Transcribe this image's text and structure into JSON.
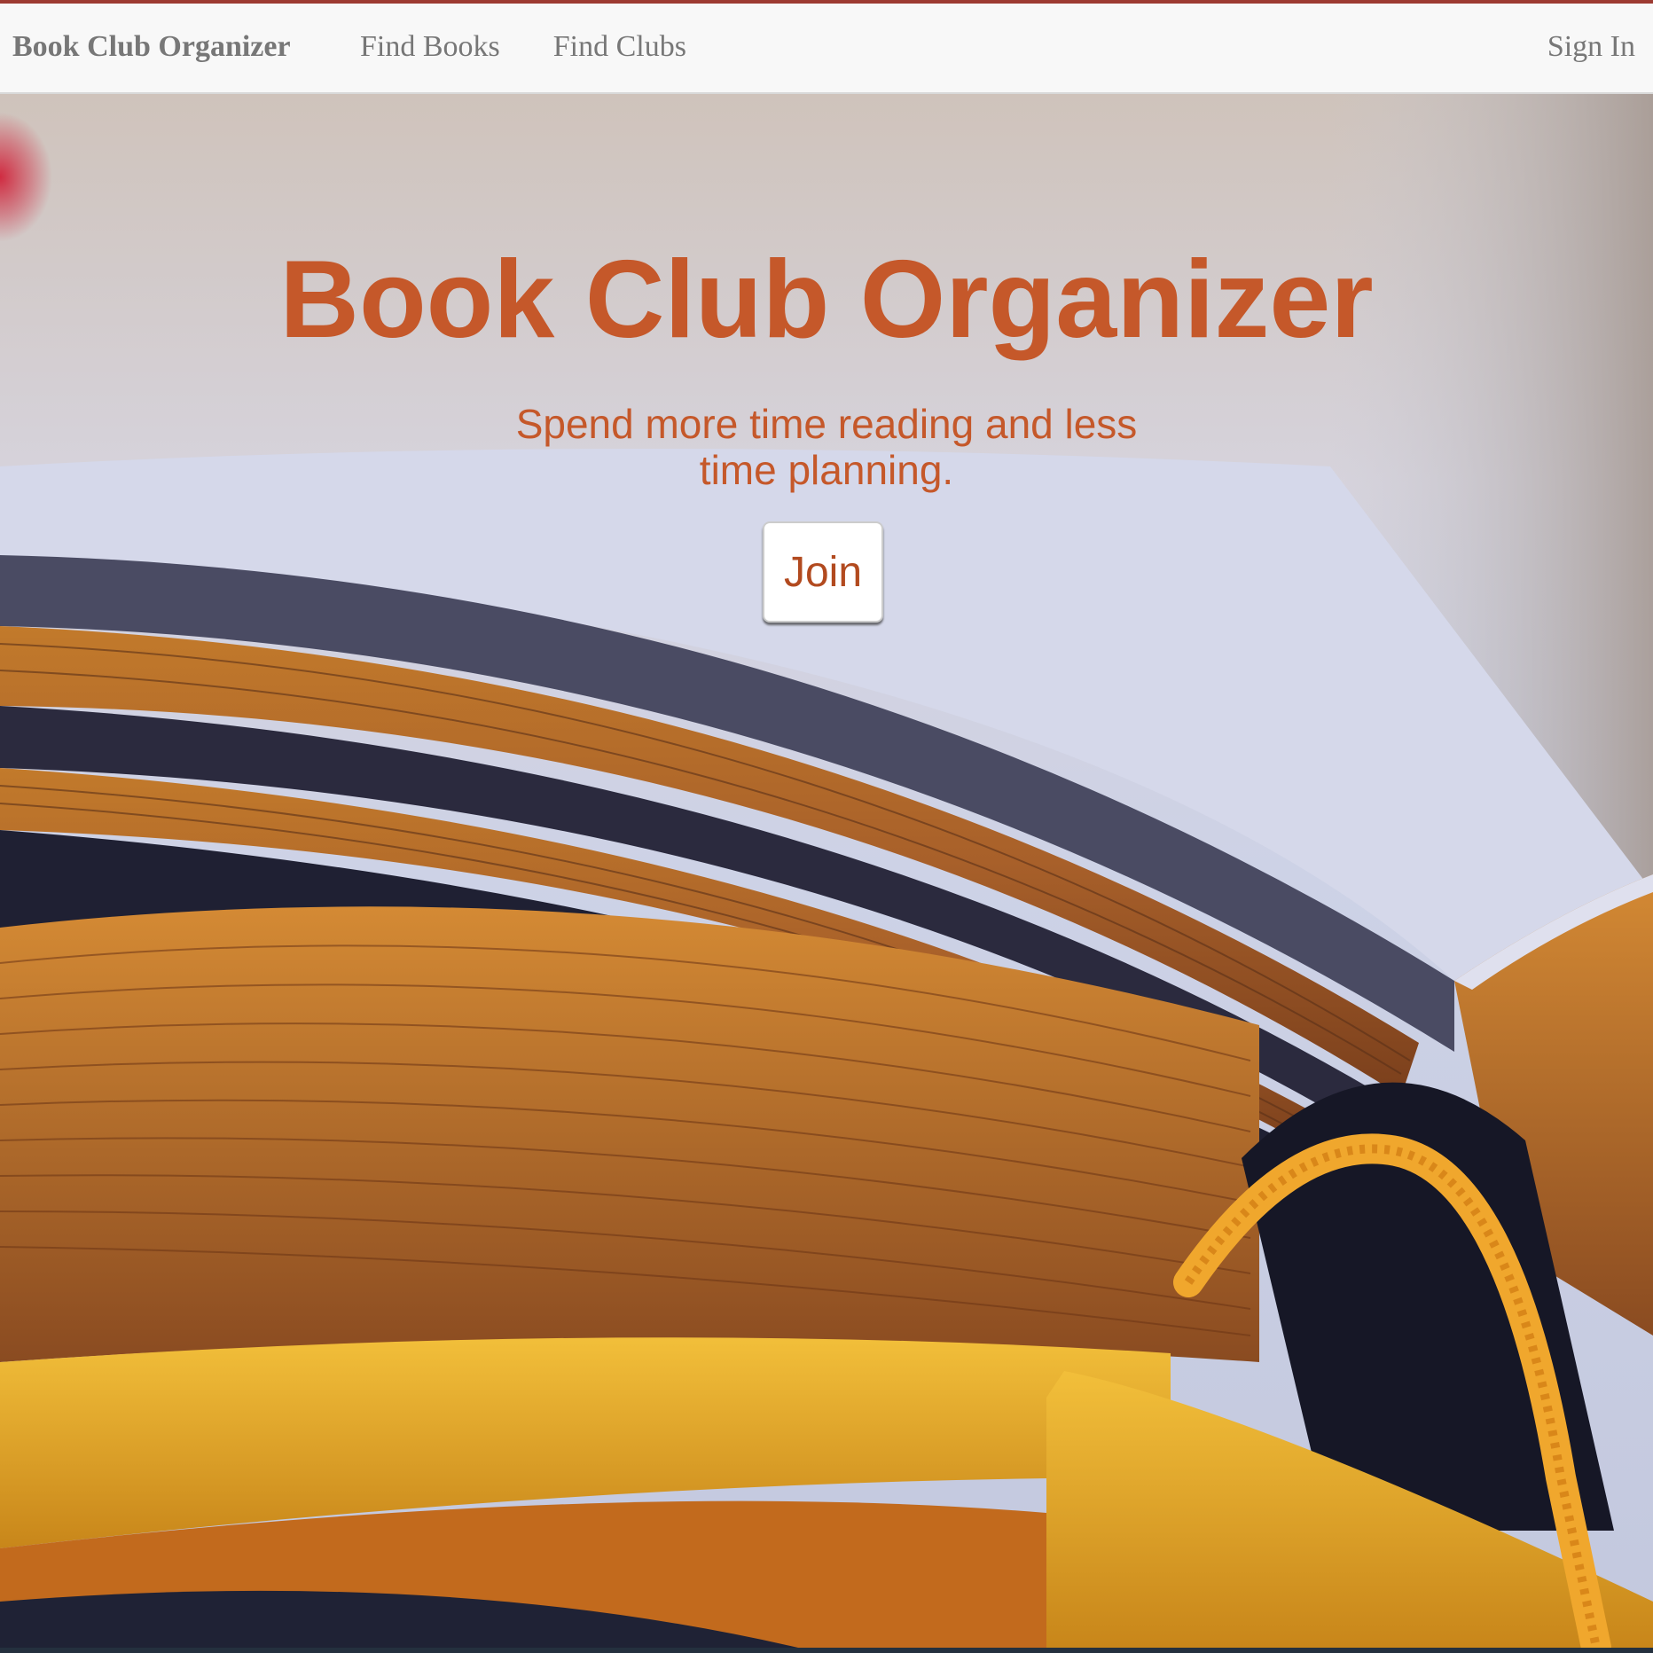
{
  "navbar": {
    "brand": "Book Club Organizer",
    "links": [
      {
        "label": "Find Books"
      },
      {
        "label": "Find Clubs"
      }
    ],
    "signin_label": "Sign In",
    "accent_color": "#9d3b32"
  },
  "hero": {
    "title": "Book Club Organizer",
    "subtitle": "Spend more time reading and less time planning.",
    "join_label": "Join",
    "text_color": "#c5582a",
    "background_image": "open-book-photo"
  }
}
